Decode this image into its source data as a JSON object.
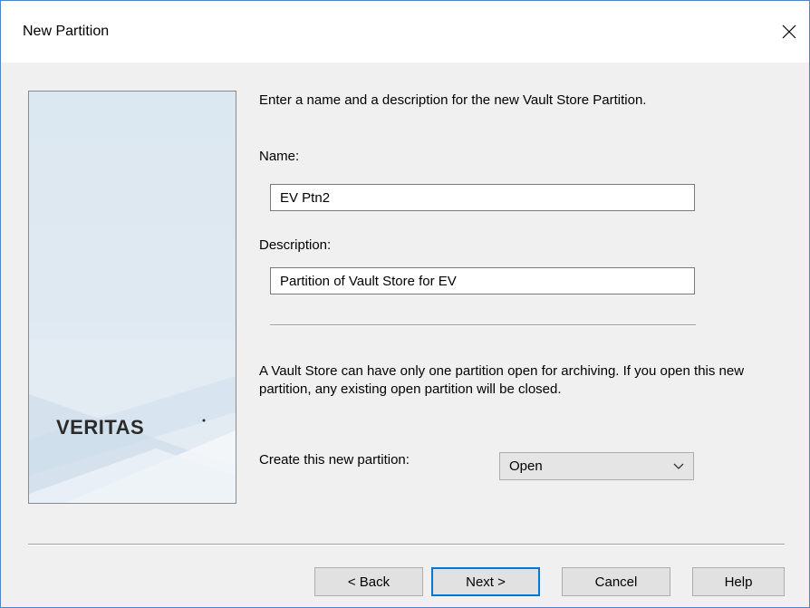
{
  "window": {
    "title": "New Partition"
  },
  "brand": {
    "logo_text": "VERITAS"
  },
  "form": {
    "intro": "Enter a name and a description for the new Vault Store Partition.",
    "name_label": "Name:",
    "name_value": "EV Ptn2",
    "description_label": "Description:",
    "description_value": "Partition of Vault Store for EV",
    "info_text": "A Vault Store can have only one partition open for archiving. If you open this new partition, any existing open partition will be closed.",
    "create_label": "Create this new partition:",
    "create_selected": "Open"
  },
  "buttons": {
    "back": "< Back",
    "next": "Next >",
    "cancel": "Cancel",
    "help": "Help"
  },
  "colors": {
    "accent": "#0078d7",
    "logo": "#2b2b2b"
  }
}
